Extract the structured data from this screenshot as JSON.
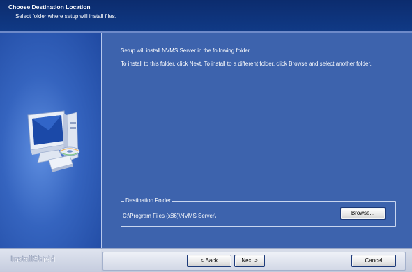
{
  "header": {
    "title": "Choose Destination Location",
    "subtitle": "Select folder where setup will install files."
  },
  "content": {
    "line1": "Setup will install NVMS Server in the following folder.",
    "line2": "To install to this folder, click Next. To install to a different folder, click Browse and select another folder."
  },
  "destination": {
    "group_label": "Destination Folder",
    "path": "C:\\Program Files (x86)\\NVMS Server\\",
    "browse_label": "Browse..."
  },
  "footer": {
    "logo_a": "Install",
    "logo_b": "Shield",
    "back_label": "< Back",
    "next_label": "Next >",
    "cancel_label": "Cancel"
  },
  "icons": {
    "illustration": "computer-with-disc-icon"
  }
}
